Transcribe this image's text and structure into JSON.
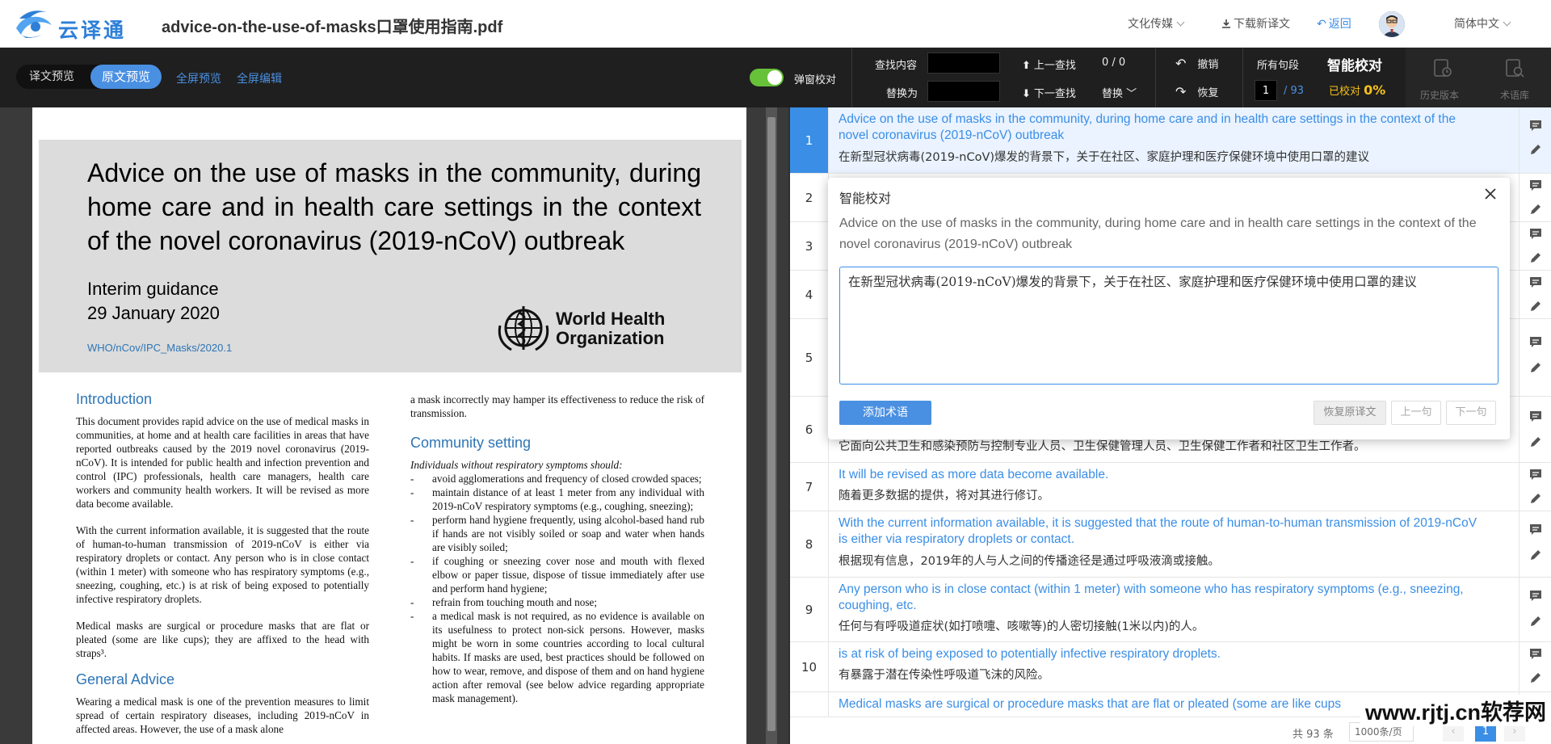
{
  "app": {
    "logo_text": "云译通",
    "doc_title": "advice-on-the-use-of-masks口罩使用指南.pdf",
    "category": "文化传媒",
    "download_label": "下载新译文",
    "back_label": "返回",
    "language": "简体中文"
  },
  "toolbar": {
    "seg_translation": "译文预览",
    "seg_original": "原文预览",
    "full_preview": "全屏预览",
    "full_edit": "全屏编辑",
    "popup_proof_label": "弹窗校对",
    "find_label": "查找内容",
    "replace_label": "替换为",
    "prev_find": "上一查找",
    "next_find": "下一查找",
    "find_count": "0 / 0",
    "replace_btn": "替换",
    "undo": "撤销",
    "redo": "恢复",
    "all_segments": "所有句段",
    "current_page": "1",
    "total_pages": "/ 93",
    "smart_proof": "智能校对",
    "proofed_label": "已校对",
    "proofed_value": "0%",
    "history": "历史版本",
    "termbase": "术语库"
  },
  "pdf": {
    "title": "Advice on the use of masks in the community, during home care and in health care settings in the context of the novel coronavirus (2019-nCoV) outbreak",
    "interim": "Interim guidance",
    "date": "29 January 2020",
    "ref": "WHO/nCov/IPC_Masks/2020.1",
    "who_line1": "World Health",
    "who_line2": "Organization",
    "intro_heading": "Introduction",
    "intro_p1": "This document provides rapid advice on the use of medical masks in communities, at home and at health care facilities in areas that have reported outbreaks caused by the 2019 novel coronavirus (2019-nCoV). It is intended for public health and infection prevention and control (IPC) professionals, health care managers, health care workers and community health workers. It will be revised as more data become available.",
    "intro_p2": "With the current information available, it is suggested that the route of human-to-human transmission of 2019-nCoV is either via respiratory droplets or contact. Any person who is in close contact (within 1 meter) with someone who has respiratory symptoms (e.g., sneezing, coughing, etc.) is at risk of being exposed to potentially infective respiratory droplets.",
    "intro_p3": "Medical masks are surgical or procedure masks that are flat or pleated (some are like cups); they are affixed to the head with straps³.",
    "general_heading": "General Advice",
    "general_p1": "Wearing a medical mask is one of the prevention measures to limit spread of certain respiratory diseases, including 2019-nCoV in affected areas. However, the use of a mask alone",
    "col2_top": "a mask incorrectly may hamper its effectiveness to reduce the risk of transmission.",
    "community_heading": "Community setting",
    "community_intro": "Individuals without respiratory symptoms should:",
    "community_items": [
      "avoid agglomerations and frequency of closed crowded spaces;",
      "maintain distance of at least 1 meter from any individual with 2019-nCoV respiratory symptoms (e.g., coughing, sneezing);",
      "perform hand hygiene frequently, using alcohol-based hand rub if hands are not visibly soiled or soap and water when hands are visibly soiled;",
      "if coughing or sneezing cover nose and mouth with flexed elbow or paper tissue, dispose of tissue immediately after use  and perform hand hygiene;",
      "refrain from touching mouth and nose;",
      "a medical mask is not required, as no evidence is available on its usefulness to protect non-sick persons. However, masks might be worn in some countries according to local cultural habits. If masks are used, best practices should be followed on how to wear, remove, and dispose of them and on hand hygiene action after removal (see below advice regarding appropriate mask management)."
    ]
  },
  "segments": [
    {
      "num": "1",
      "src": "Advice on the use of masks in the community, during home care and in health care settings in the context of the novel coronavirus (2019-nCoV) outbreak",
      "tgt": "在新型冠状病毒(2019-nCoV)爆发的背景下，关于在社区、家庭护理和医疗保健环境中使用口罩的建议"
    },
    {
      "num": "2",
      "src": "",
      "tgt": ""
    },
    {
      "num": "3",
      "src": "",
      "tgt": ""
    },
    {
      "num": "4",
      "src": "",
      "tgt": ""
    },
    {
      "num": "5",
      "src": "",
      "tgt": ""
    },
    {
      "num": "6",
      "src": "",
      "tgt": "它面向公共卫生和感染预防与控制专业人员、卫生保健管理人员、卫生保健工作者和社区卫生工作者。"
    },
    {
      "num": "7",
      "src": "It will be revised as more data become available.",
      "tgt": "随着更多数据的提供，将对其进行修订。"
    },
    {
      "num": "8",
      "src": "With the current information available, it is suggested that the route of human-to-human transmission of 2019-nCoV is either via respiratory droplets or contact.",
      "tgt": "根据现有信息，2019年的人与人之间的传播途径是通过呼吸液滴或接触。"
    },
    {
      "num": "9",
      "src": "Any person who is in close contact (within 1 meter) with someone who has respiratory symptoms (e.g., sneezing, coughing, etc.",
      "tgt": "任何与有呼吸道症状(如打喷嚏、咳嗽等)的人密切接触(1米以内)的人。"
    },
    {
      "num": "10",
      "src": "is at risk of being exposed to potentially infective respiratory droplets.",
      "tgt": "有暴露于潜在传染性呼吸道飞沫的风险。"
    },
    {
      "num": "",
      "src": "Medical masks are surgical or procedure masks that are flat or pleated (some are like cups",
      "tgt": ""
    }
  ],
  "pager": {
    "total": "共 93 条",
    "per_page": "1000条/页",
    "current": "1"
  },
  "popup": {
    "title": "智能校对",
    "source": "Advice on the use of masks in the community, during home care and in health care settings in the context of the novel coronavirus (2019-nCoV) outbreak",
    "translation": "在新型冠状病毒(2019-nCoV)爆发的背景下，关于在社区、家庭护理和医疗保健环境中使用口罩的建议",
    "add_term": "添加术语",
    "restore": "恢复原译文",
    "prev": "上一句",
    "next": "下一句"
  },
  "watermark": "www.rjtj.cn软荐网",
  "colors": {
    "accent": "#4a90e2",
    "active_row": "#3a8ee6",
    "toggle_on": "#67c23a",
    "proof_yellow": "#f5c11a"
  }
}
